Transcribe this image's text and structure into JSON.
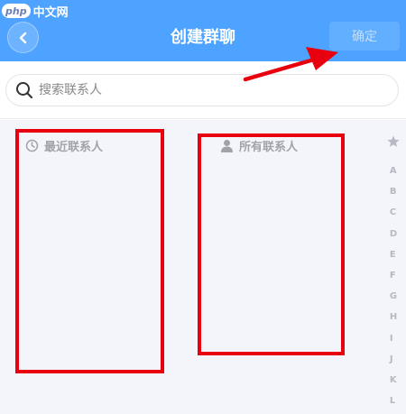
{
  "watermark": {
    "logo": "php",
    "text": "中文网"
  },
  "header": {
    "title": "创建群聊",
    "confirm_label": "确定"
  },
  "search": {
    "placeholder": "搜索联系人"
  },
  "sections": {
    "recent_label": "最近联系人",
    "all_label": "所有联系人"
  },
  "index_bar": [
    "A",
    "B",
    "C",
    "D",
    "E",
    "F",
    "G",
    "H",
    "I",
    "J",
    "K",
    "L"
  ],
  "colors": {
    "header_blue": "#4da3ff",
    "highlight_red": "#e8000f",
    "content_bg": "#f4f5fa"
  },
  "icons": {
    "back": "chevron-left-icon",
    "search": "search-icon",
    "recent": "clock-icon",
    "all": "person-icon",
    "index_top": "star-icon"
  }
}
